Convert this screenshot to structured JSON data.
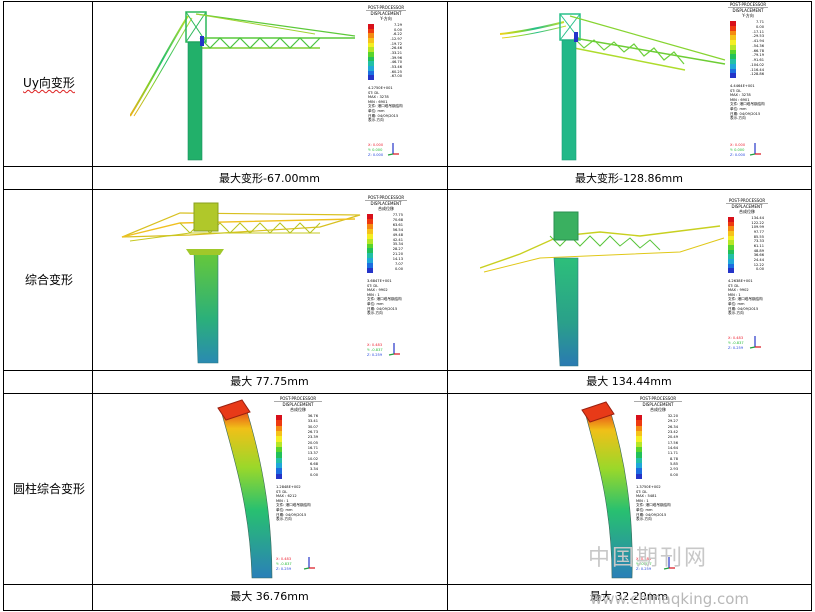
{
  "rows": [
    {
      "label": "Uy向变形",
      "captions": [
        "最大变形-67.00mm",
        "最大变形-128.86mm"
      ],
      "panels": [
        {
          "header": "POST-PROCESSOR",
          "subheader": "DISPLACEMENT",
          "component": "Y-方向",
          "values": [
            "7.29",
            "0.00",
            "-6.22",
            "-12.97",
            "-19.72",
            "-26.46",
            "-33.21",
            "-39.96",
            "-46.70",
            "-53.46",
            "-60.25",
            "-67.00"
          ],
          "factor": "4.2750E+001",
          "st": "ST: DL",
          "max": "MAX : 3278",
          "min": "MIN : 6901",
          "file": "文件: 港口塔吊钢结构",
          "unit": "单位: mm",
          "date": "日期: 04/09/2015",
          "view": "表示-方向",
          "axes": [
            "X: 0.000",
            "Y: 0.000",
            "Z: 0.000"
          ]
        },
        {
          "header": "POST-PROCESSOR",
          "subheader": "DISPLACEMENT",
          "component": "Y-方向",
          "values": [
            "7.71",
            "0.00",
            "-17.11",
            "-29.53",
            "-41.94",
            "-54.36",
            "-66.78",
            "-79.19",
            "-91.61",
            "-104.02",
            "-116.44",
            "-128.86"
          ],
          "factor": "4.4464E+001",
          "st": "ST: DL",
          "max": "MAX : 3278",
          "min": "MIN : 6901",
          "file": "文件: 港口塔吊钢结构",
          "unit": "单位: mm",
          "date": "日期: 04/09/2015",
          "view": "表示-方向",
          "axes": [
            "X: 0.000",
            "Y: 0.000",
            "Z: 0.000"
          ]
        }
      ]
    },
    {
      "label": "综合变形",
      "captions": [
        "最大 77.75mm",
        "最大 134.44mm"
      ],
      "panels": [
        {
          "header": "POST-PROCESSOR",
          "subheader": "DISPLACEMENT",
          "component": "合成位移",
          "values": [
            "77.75",
            "70.68",
            "63.61",
            "56.54",
            "49.48",
            "42.41",
            "35.34",
            "28.27",
            "21.20",
            "14.13",
            "7.07",
            "0.00"
          ],
          "factor": "3.6847E+001",
          "st": "ST: DL",
          "max": "MAX : 9902",
          "min": "MIN : 1",
          "file": "文件: 港口塔吊钢结构",
          "unit": "单位: mm",
          "date": "日期: 04/09/2015",
          "view": "表示-方向",
          "axes": [
            "X: 0.483",
            "Y: -0.837",
            "Z: 0.259"
          ]
        },
        {
          "header": "POST-PROCESSOR",
          "subheader": "DISPLACEMENT",
          "component": "合成位移",
          "values": [
            "134.44",
            "122.22",
            "109.99",
            "97.77",
            "85.55",
            "73.33",
            "61.11",
            "48.89",
            "36.66",
            "24.44",
            "12.22",
            "0.00"
          ],
          "factor": "4.2638E+001",
          "st": "ST: DL",
          "max": "MAX : 9902",
          "min": "MIN : 1",
          "file": "文件: 港口塔吊钢结构",
          "unit": "单位: mm",
          "date": "日期: 04/09/2015",
          "view": "表示-方向",
          "axes": [
            "X: 0.483",
            "Y: -0.837",
            "Z: 0.259"
          ]
        }
      ]
    },
    {
      "label": "圆柱综合变形",
      "captions": [
        "最大 36.76mm",
        "最大 32.20mm"
      ],
      "panels": [
        {
          "header": "POST-PROCESSOR",
          "subheader": "DISPLACEMENT",
          "component": "合成位移",
          "values": [
            "36.76",
            "33.41",
            "30.07",
            "26.73",
            "23.39",
            "20.05",
            "16.71",
            "13.37",
            "10.02",
            "6.68",
            "3.34",
            "0.00"
          ],
          "factor": "1.2848E+002",
          "st": "ST: DL",
          "max": "MAX : 6212",
          "min": "MIN : 1",
          "file": "文件: 港口塔吊钢结构",
          "unit": "单位: mm",
          "date": "日期: 04/09/2015",
          "view": "表示-方向",
          "axes": [
            "X: 0.483",
            "Y: -0.837",
            "Z: 0.259"
          ]
        },
        {
          "header": "POST-PROCESSOR",
          "subheader": "DISPLACEMENT",
          "component": "合成位移",
          "values": [
            "32.20",
            "29.27",
            "26.34",
            "23.42",
            "20.49",
            "17.56",
            "14.64",
            "11.71",
            "8.78",
            "5.85",
            "2.93",
            "0.00"
          ],
          "factor": "1.3750E+002",
          "st": "ST: DL",
          "max": "MAX : 5481",
          "min": "MIN : 1",
          "file": "文件: 港口塔吊钢结构",
          "unit": "单位: mm",
          "date": "日期: 04/09/2015",
          "view": "表示-方向",
          "axes": [
            "X: 0.483",
            "Y: -0.837",
            "Z: 0.259"
          ]
        }
      ]
    }
  ],
  "legend_colors": [
    "#d8101a",
    "#ee3a10",
    "#f48a12",
    "#f6c21a",
    "#f4ee22",
    "#b6e626",
    "#58d42c",
    "#22c05a",
    "#22c0a6",
    "#20a8d8",
    "#1c6ee0",
    "#2434c8"
  ],
  "watermark": {
    "cn": "中国期刊网",
    "url": "www.chinaqking.com"
  }
}
